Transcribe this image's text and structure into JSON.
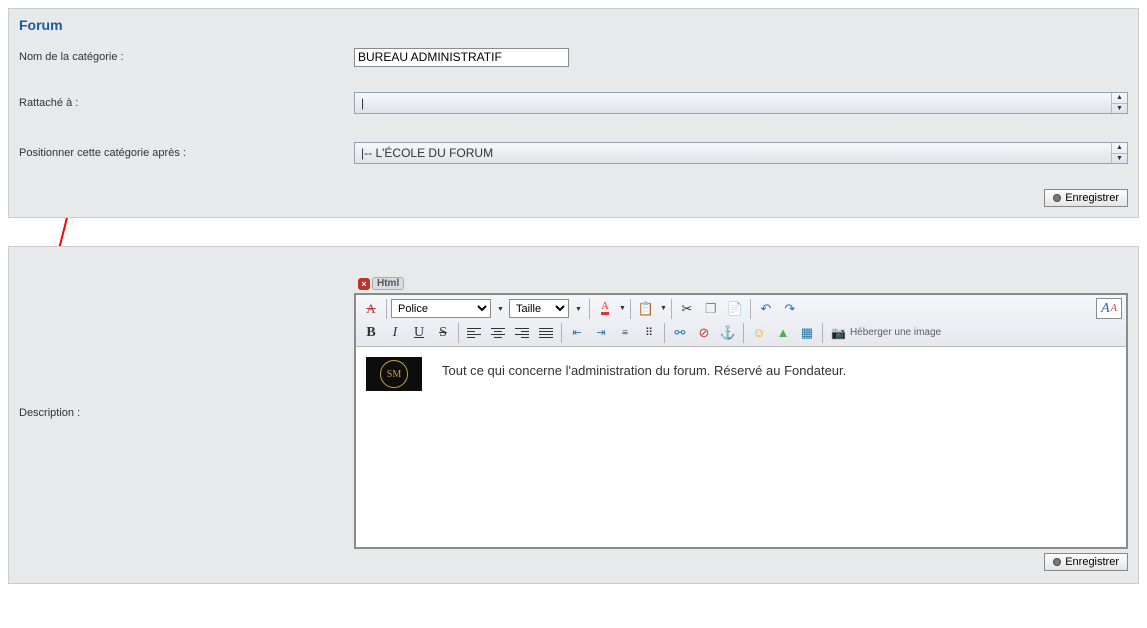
{
  "section_title": "Forum",
  "labels": {
    "category_name": "Nom de la catégorie :",
    "attached_to": "Rattaché à :",
    "position_after": "Positionner cette catégorie après :",
    "description": "Description :"
  },
  "fields": {
    "category_name_value": "BUREAU ADMINISTRATIF",
    "attached_to_value": "|",
    "position_after_value": "|-- L'ÉCOLE DU FORUM"
  },
  "buttons": {
    "save": "Enregistrer"
  },
  "editor": {
    "mode_label": "Html",
    "font_select": "Police",
    "size_select": "Taille",
    "host_image": "Héberger une image",
    "content_text": "Tout ce qui concerne l'administration du forum. Réservé au Fondateur.",
    "badge_text": "SM",
    "format_box": "A"
  },
  "icons": {
    "remove_format": "A̶",
    "font_color": "A",
    "cut": "✂",
    "copy": "📋",
    "paste": "📄",
    "undo": "↶",
    "redo": "↷",
    "outdent": "⇤",
    "indent": "⇥",
    "ul": "≡",
    "ol": "⋮≡",
    "link": "🔗",
    "anchor": "⚓",
    "unlink": "✖",
    "table": "▦",
    "image": "🖼",
    "flash": "⚡",
    "video": "▭",
    "face": "☺",
    "camera": "📷"
  }
}
